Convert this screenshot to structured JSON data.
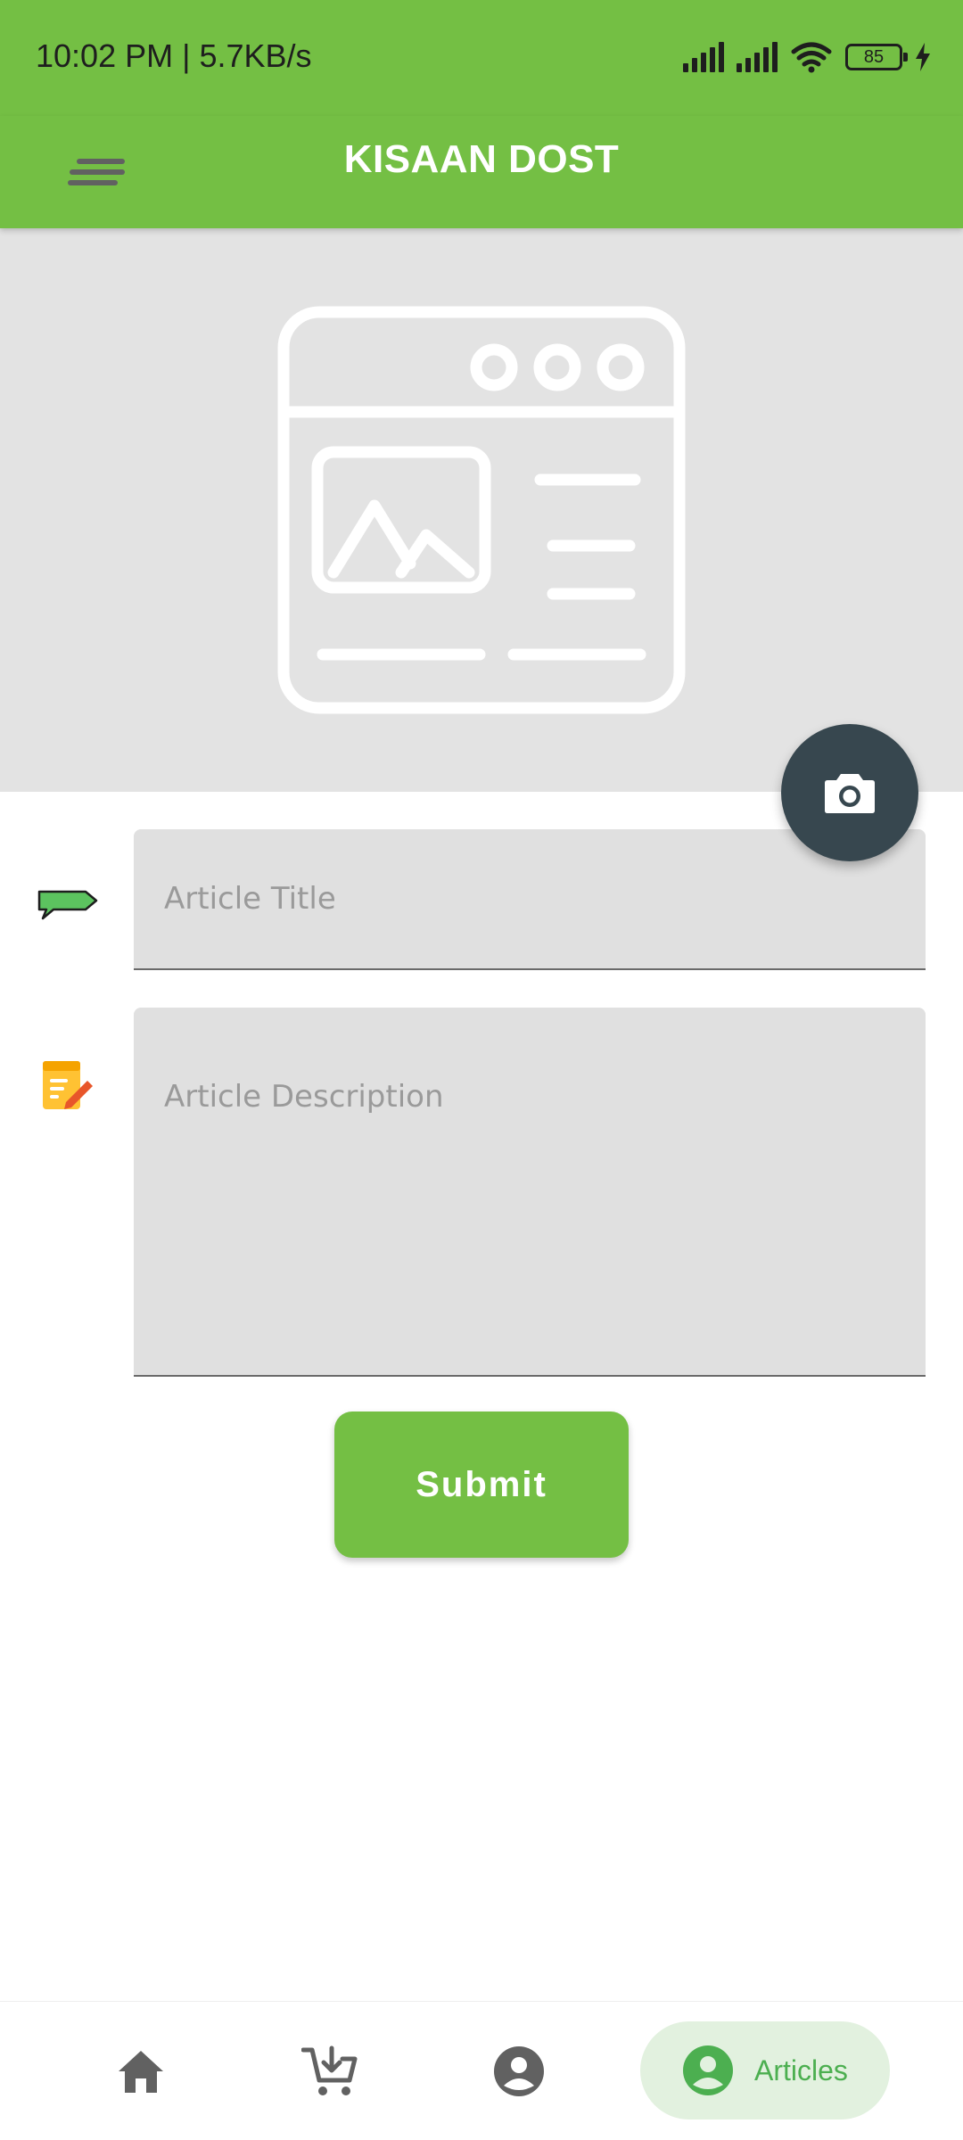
{
  "status_bar": {
    "time_speed": "10:02 PM | 5.7KB/s",
    "battery_level": "85",
    "icons": [
      "signal-icon",
      "signal-icon",
      "wifi-icon",
      "battery-icon",
      "charging-icon"
    ]
  },
  "app_bar": {
    "title": "KISAAN DOST",
    "menu_icon": "menu-icon"
  },
  "image_picker": {
    "placeholder_icon": "article-image-placeholder-icon",
    "camera_icon": "camera-icon"
  },
  "form": {
    "title_placeholder": "Article Title",
    "title_value": "",
    "title_icon": "tag-icon",
    "description_placeholder": "Article Description",
    "description_value": "",
    "description_icon": "notepad-edit-icon",
    "submit_label": "Submit"
  },
  "bottom_nav": {
    "items": [
      {
        "icon": "home-icon",
        "label": ""
      },
      {
        "icon": "cart-icon",
        "label": ""
      },
      {
        "icon": "account-icon",
        "label": ""
      },
      {
        "icon": "account-icon",
        "label": "Articles",
        "active": true
      }
    ]
  },
  "colors": {
    "primary_green": "#74bf44",
    "fab_dark": "#37474f",
    "field_gray": "#e0e0e0",
    "active_nav_bg": "#e2f1df",
    "active_nav_text": "#4caf50"
  }
}
